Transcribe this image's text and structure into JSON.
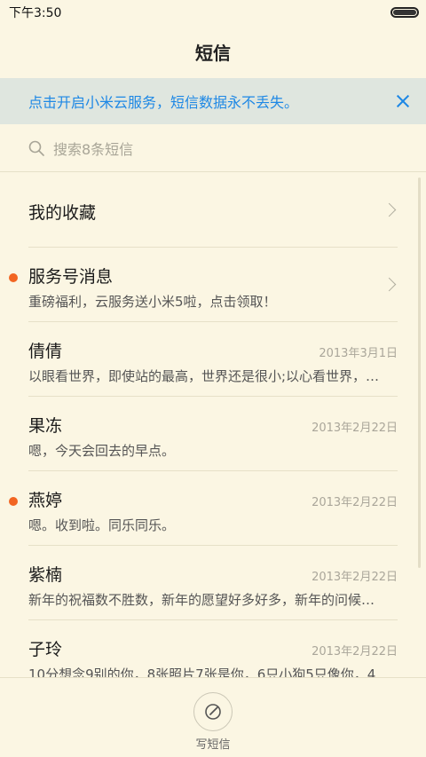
{
  "status": {
    "time": "下午3:50"
  },
  "header": {
    "title": "短信"
  },
  "banner": {
    "text": "点击开启小米云服务，短信数据永不丢失。"
  },
  "search": {
    "placeholder": "搜索8条短信"
  },
  "favorites": {
    "label": "我的收藏"
  },
  "service": {
    "name": "服务号消息",
    "preview": "重磅福利，云服务送小米5啦，点击领取！"
  },
  "threads": [
    {
      "name": "倩倩",
      "date": "2013年3月1日",
      "preview": "以眼看世界，即使站的最高，世界还是很小;以心看世界，…"
    },
    {
      "name": "果冻",
      "date": "2013年2月22日",
      "preview": "嗯，今天会回去的早点。"
    },
    {
      "name": "燕婷",
      "date": "2013年2月22日",
      "preview": "嗯。收到啦。同乐同乐。"
    },
    {
      "name": "紫楠",
      "date": "2013年2月22日",
      "preview": "新年的祝福数不胜数，新年的愿望好多好多，新年的问候…"
    },
    {
      "name": "子玲",
      "date": "2013年2月22日",
      "preview": "10分想念9别的你，8张照片7张是你，6只小狗5只像你，4…"
    }
  ],
  "compose": {
    "label": "写短信"
  },
  "colors": {
    "background": "#fbf6e3",
    "accent": "#1e88e5",
    "unread": "#f26522"
  }
}
